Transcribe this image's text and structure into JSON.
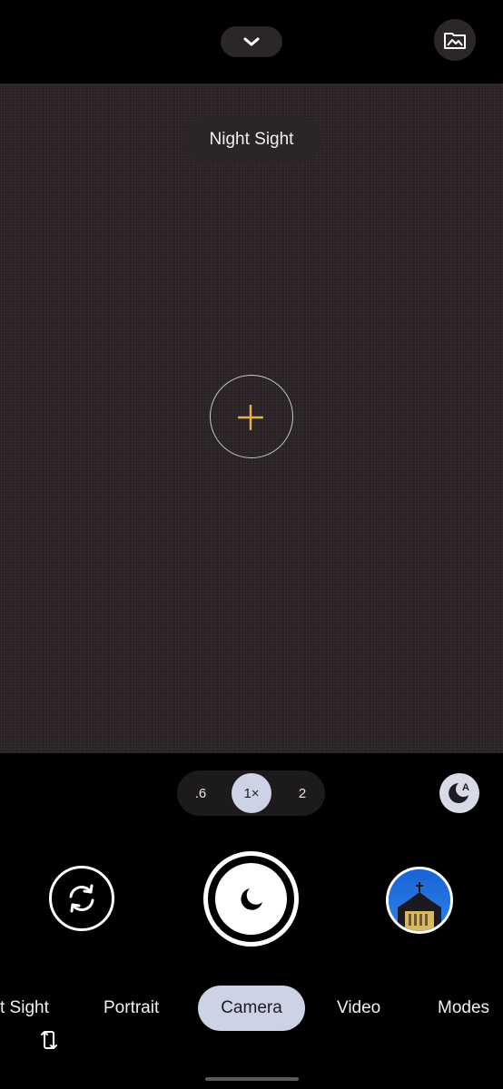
{
  "viewfinder": {
    "mode_chip": "Night Sight"
  },
  "zoom": {
    "options": [
      ".6",
      "1×",
      "2"
    ],
    "selected": "1×"
  },
  "modes": {
    "items": [
      "t Sight",
      "Portrait",
      "Camera",
      "Video",
      "Modes"
    ],
    "selected": "Camera"
  },
  "icons": {
    "top_chevron": "chevron-down-icon",
    "gallery": "gallery-folder-icon",
    "focus": "focus-crosshair-icon",
    "night_auto": "night-sight-auto-icon",
    "switch_camera": "switch-camera-icon",
    "shutter": "night-shutter-moon-icon",
    "rotate": "rotate-device-icon"
  },
  "colors": {
    "accent_pill": "#cdd2e4",
    "focus_cross": "#e8b04a",
    "viewfinder": "#2a2326",
    "thumbnail_sky": "#1d6fde"
  }
}
